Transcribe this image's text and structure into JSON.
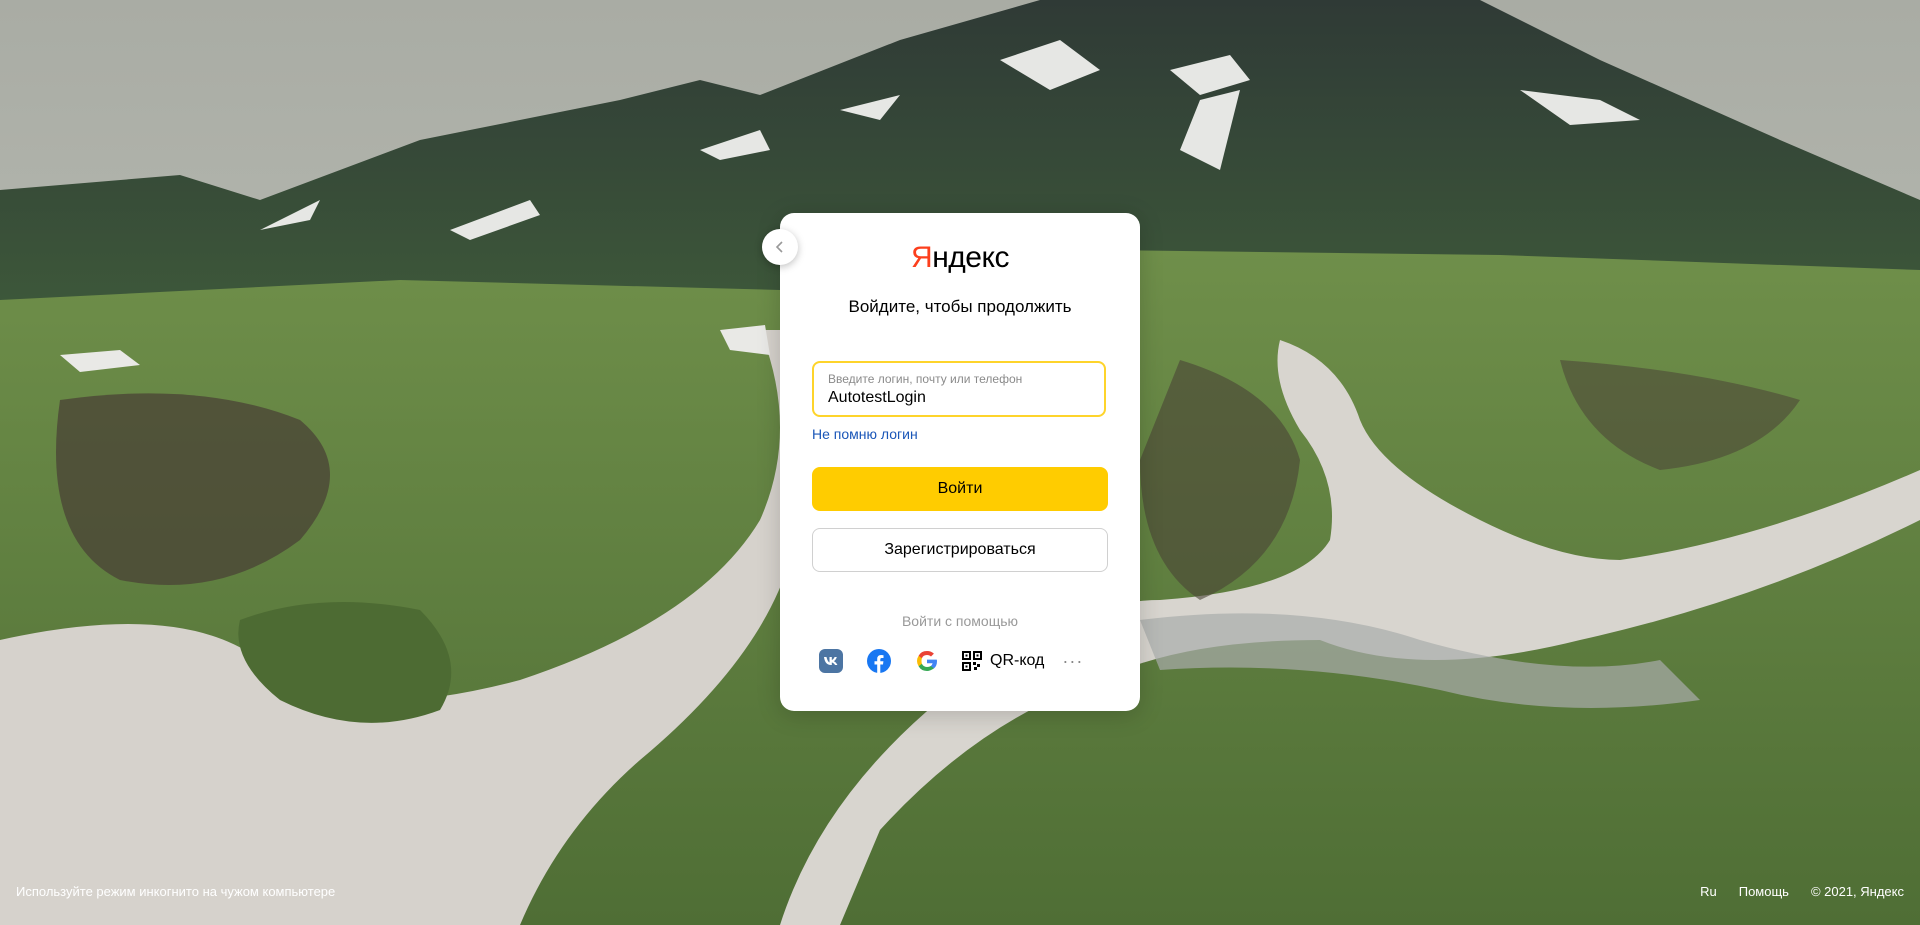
{
  "brand": {
    "logo_first": "Я",
    "logo_rest": "ндекс"
  },
  "form": {
    "subtitle": "Войдите, чтобы продолжить",
    "login_placeholder": "Введите логин, почту или телефон",
    "login_value": "AutotestLogin",
    "forgot_link": "Не помню логин",
    "login_button": "Войти",
    "register_button": "Зарегистрироваться"
  },
  "alt_login": {
    "label": "Войти с помощью",
    "providers": [
      {
        "icon": "vk-icon",
        "color": "#4c75a3"
      },
      {
        "icon": "facebook-icon",
        "color": "#1877f2"
      },
      {
        "icon": "google-icon",
        "color": "#4285f4"
      }
    ],
    "qr_label": "QR-код",
    "more": "···"
  },
  "footer": {
    "incognito_hint": "Используйте режим инкогнито на чужом компьютере",
    "lang": "Ru",
    "help": "Помощь",
    "copyright": "© 2021, Яндекс"
  },
  "colors": {
    "accent": "#ffcc00",
    "logo_red": "#fc3f1d",
    "focus_border": "#fed42b",
    "link": "#1a56b8"
  }
}
